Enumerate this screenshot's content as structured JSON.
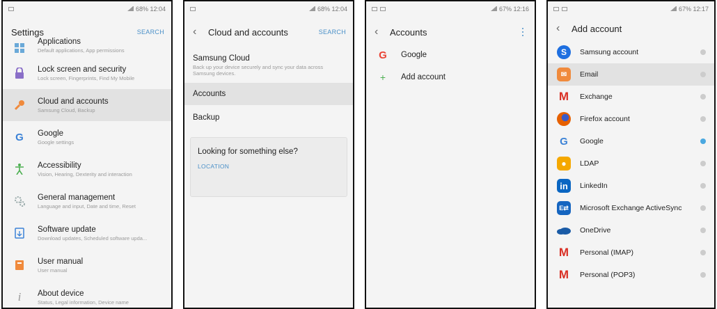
{
  "panels": [
    {
      "status": {
        "right": "68% 12:04"
      },
      "appbar": {
        "title": "Settings",
        "action": "SEARCH"
      },
      "items": [
        {
          "title": "Applications",
          "subtitle": "Default applications, App permissions",
          "icon": "apps-grid-icon"
        },
        {
          "title": "Lock screen and security",
          "subtitle": "Lock screen, Fingerprints, Find My Mobile",
          "icon": "lock-icon"
        },
        {
          "title": "Cloud and accounts",
          "subtitle": "Samsung Cloud, Backup",
          "icon": "key-icon",
          "selected": true
        },
        {
          "title": "Google",
          "subtitle": "Google settings",
          "icon": "google-g-icon"
        },
        {
          "title": "Accessibility",
          "subtitle": "Vision, Hearing, Dexterity and interaction",
          "icon": "accessibility-icon"
        },
        {
          "title": "General management",
          "subtitle": "Language and input, Date and time, Reset",
          "icon": "gears-icon"
        },
        {
          "title": "Software update",
          "subtitle": "Download updates, Scheduled software upda...",
          "icon": "update-icon"
        },
        {
          "title": "User manual",
          "subtitle": "User manual",
          "icon": "book-icon"
        },
        {
          "title": "About device",
          "subtitle": "Status, Legal information, Device name",
          "icon": "info-icon"
        }
      ]
    },
    {
      "status": {
        "right": "68% 12:04"
      },
      "appbar": {
        "title": "Cloud and accounts",
        "action": "SEARCH"
      },
      "samsung_cloud": {
        "title": "Samsung Cloud",
        "subtitle": "Back up your device securely and sync your data across Samsung devices."
      },
      "accounts": "Accounts",
      "backup": "Backup",
      "card": {
        "question": "Looking for something else?",
        "link": "LOCATION"
      }
    },
    {
      "status": {
        "right": "67% 12:16"
      },
      "appbar": {
        "title": "Accounts"
      },
      "items": [
        {
          "title": "Google",
          "icon": "google-g-icon"
        },
        {
          "title": "Add account",
          "icon": "plus-icon"
        }
      ]
    },
    {
      "status": {
        "right": "67% 12:17"
      },
      "appbar": {
        "title": "Add account"
      },
      "items": [
        {
          "title": "Samsung account",
          "icon": "samsung-icon",
          "color": "#1e6fe0"
        },
        {
          "title": "Email",
          "icon": "email-icon",
          "color": "#f08a3c",
          "selected": true
        },
        {
          "title": "Exchange",
          "icon": "gmail-m-icon",
          "color": "#d93025"
        },
        {
          "title": "Firefox account",
          "icon": "firefox-icon",
          "color": "#e66000"
        },
        {
          "title": "Google",
          "icon": "google-g-icon",
          "checked": true
        },
        {
          "title": "LDAP",
          "icon": "ldap-icon",
          "color": "#f5a800"
        },
        {
          "title": "LinkedIn",
          "icon": "linkedin-icon",
          "color": "#0a66c2"
        },
        {
          "title": "Microsoft Exchange ActiveSync",
          "icon": "exchange-icon",
          "color": "#1565c0"
        },
        {
          "title": "OneDrive",
          "icon": "onedrive-icon",
          "color": "#1a5ba6"
        },
        {
          "title": "Personal (IMAP)",
          "icon": "gmail-m-icon",
          "color": "#d93025"
        },
        {
          "title": "Personal (POP3)",
          "icon": "gmail-m-icon",
          "color": "#d93025"
        }
      ]
    }
  ]
}
